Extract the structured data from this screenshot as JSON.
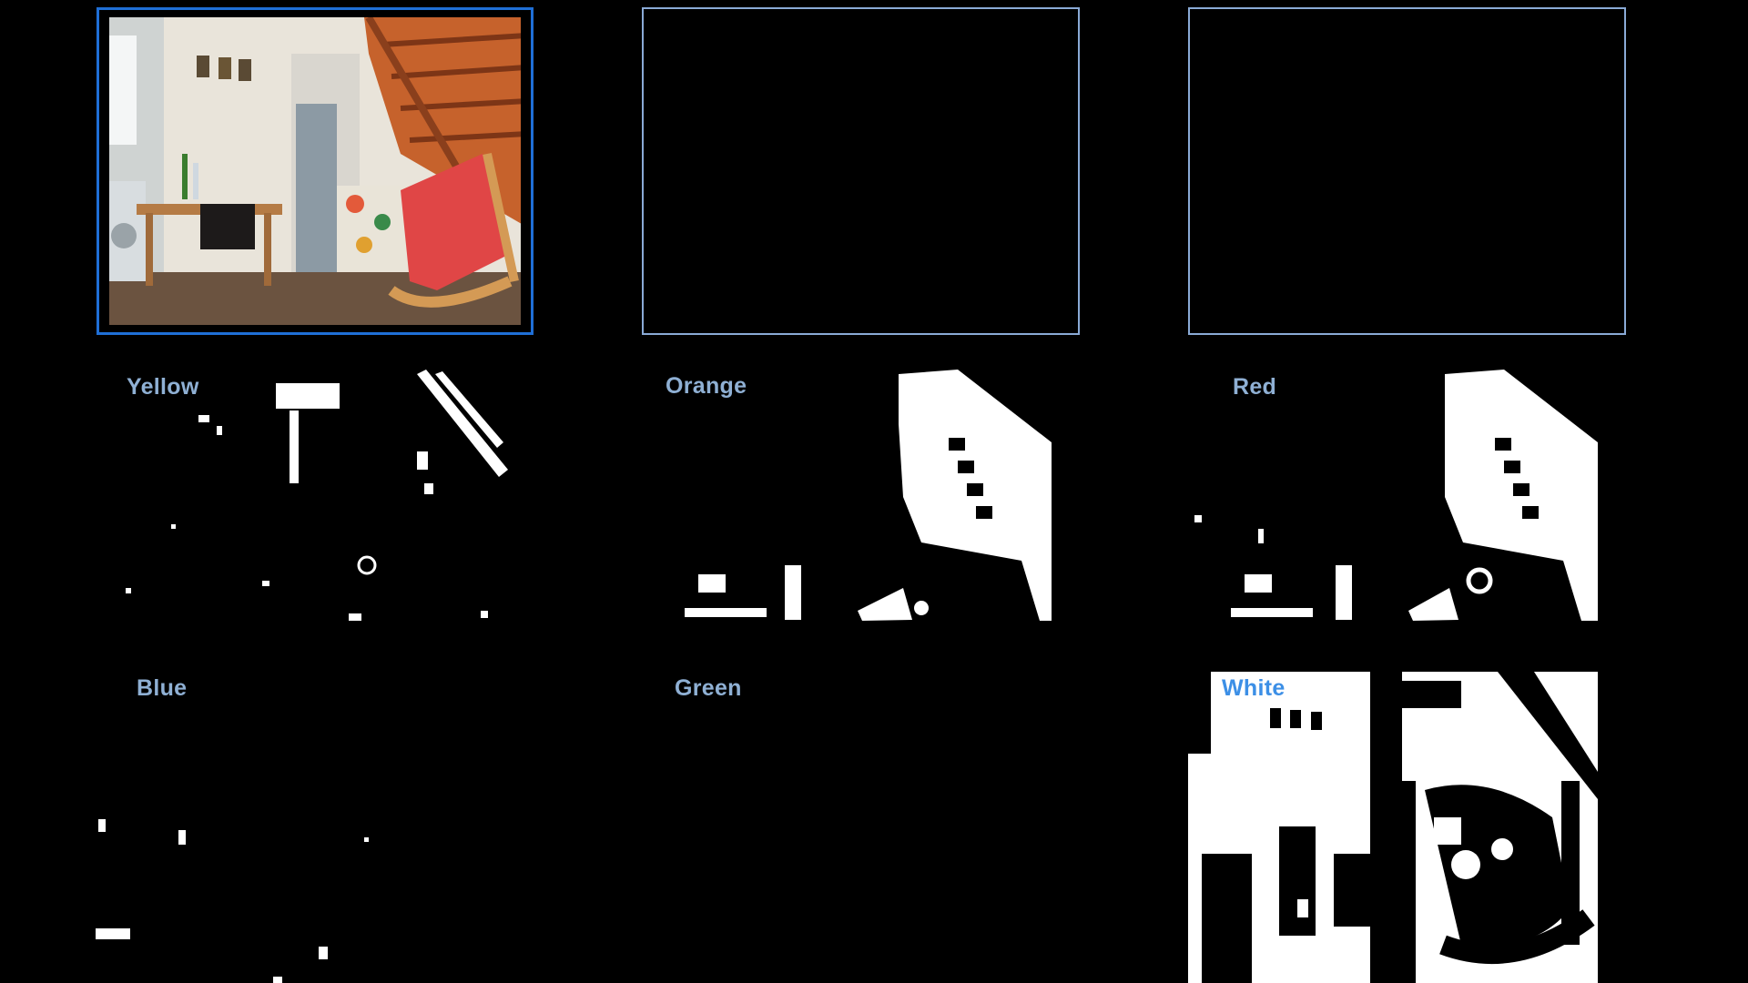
{
  "window": {
    "width": 1920,
    "height": 1080
  },
  "colors": {
    "background": "#000000",
    "selected_border": "#1f6fd6",
    "unselected_border": "#8aaad6",
    "label_default": "#8fb0d4",
    "label_active": "#3c8fe6",
    "mask_fg": "#ffffff"
  },
  "camera_frames": [
    {
      "id": "live-camera",
      "selected": true,
      "content": "room-scene"
    },
    {
      "id": "frame-2",
      "selected": false,
      "content": "empty"
    },
    {
      "id": "frame-3",
      "selected": false,
      "content": "empty"
    }
  ],
  "color_masks": [
    {
      "label": "Yellow",
      "active": false,
      "coverage": "sparse"
    },
    {
      "label": "Orange",
      "active": false,
      "coverage": "stairs"
    },
    {
      "label": "Red",
      "active": false,
      "coverage": "stairs"
    },
    {
      "label": "Blue",
      "active": false,
      "coverage": "minimal"
    },
    {
      "label": "Green",
      "active": false,
      "coverage": "none"
    },
    {
      "label": "White",
      "active": true,
      "coverage": "dense"
    }
  ]
}
